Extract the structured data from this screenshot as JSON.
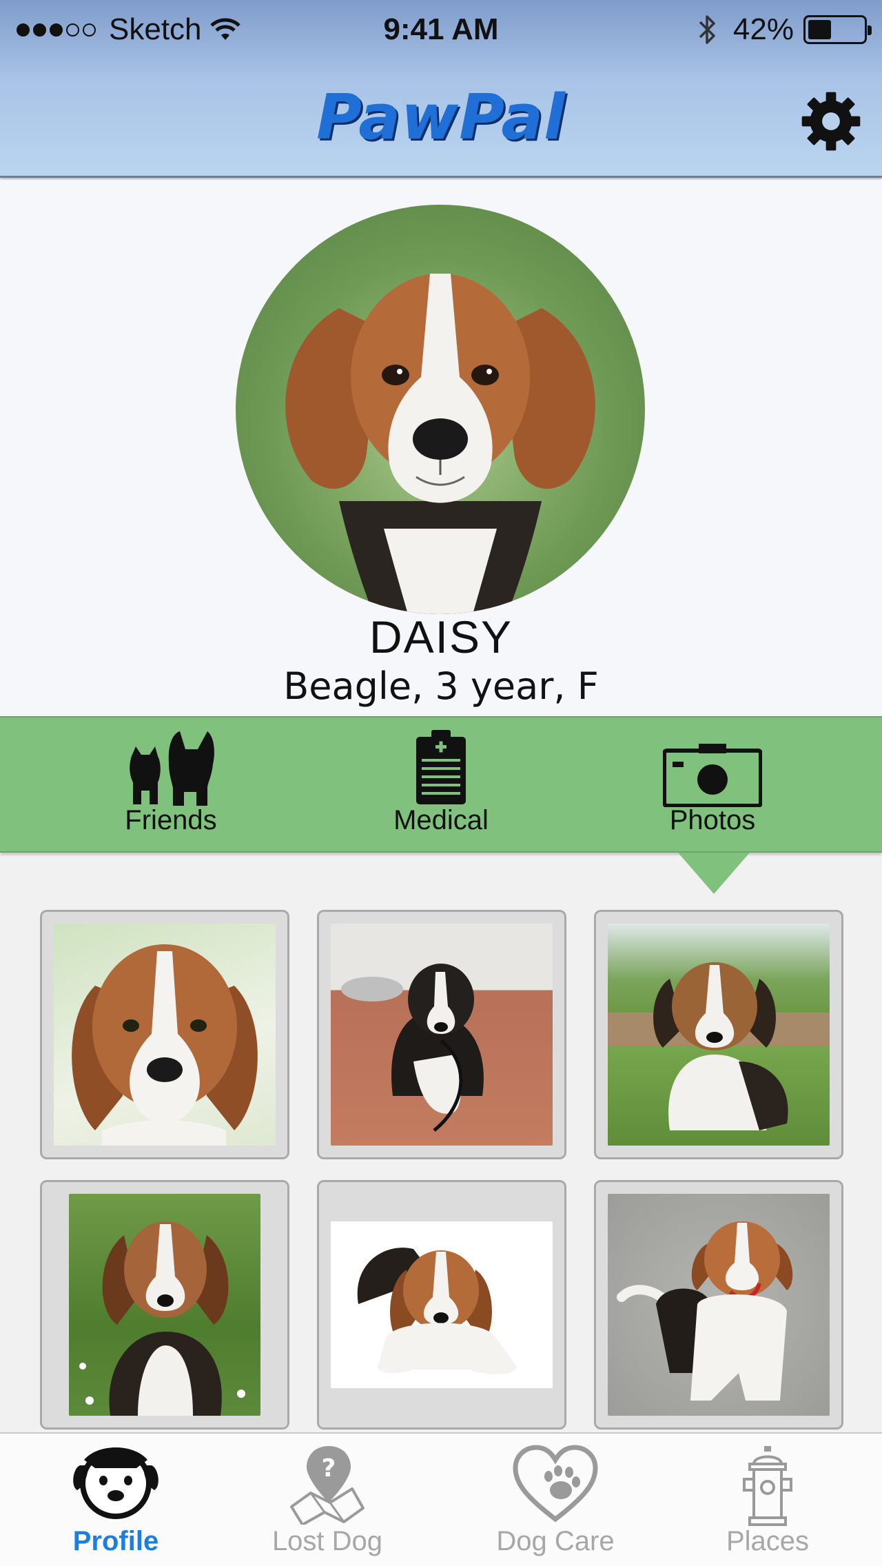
{
  "status_bar": {
    "carrier": "Sketch",
    "time": "9:41 AM",
    "battery": "42%",
    "battery_level": 0.42,
    "signal_bars_filled": 3,
    "signal_bars_total": 5
  },
  "header": {
    "title": "PawPal",
    "settings_icon": "gear-icon"
  },
  "profile": {
    "name": "DAISY",
    "details": "Beagle, 3 year, F"
  },
  "actions": [
    {
      "id": "friends",
      "label": "Friends",
      "icon": "pets-icon"
    },
    {
      "id": "medical",
      "label": "Medical",
      "icon": "clipboard-icon"
    },
    {
      "id": "photos",
      "label": "Photos",
      "icon": "camera-icon"
    }
  ],
  "selected_action": "photos",
  "photos": [
    {
      "subject": "beagle puppy close-up"
    },
    {
      "subject": "beagle puppy on brick floor with leash"
    },
    {
      "subject": "beagle puppy sitting on grass"
    },
    {
      "subject": "beagle puppy sitting in clover"
    },
    {
      "subject": "beagle puppy lying on white background"
    },
    {
      "subject": "beagle sitting on gravel"
    }
  ],
  "tabs": [
    {
      "id": "profile",
      "label": "Profile",
      "icon": "dog-face-icon",
      "active": true
    },
    {
      "id": "lost-dog",
      "label": "Lost Dog",
      "icon": "map-pin-question-icon",
      "active": false
    },
    {
      "id": "dog-care",
      "label": "Dog Care",
      "icon": "heart-paw-icon",
      "active": false
    },
    {
      "id": "places",
      "label": "Places",
      "icon": "fire-hydrant-icon",
      "active": false
    }
  ],
  "colors": {
    "header_gradient_top": "#7f9ccb",
    "header_gradient_bottom": "#bad5ef",
    "logo": "#1f6fd6",
    "action_bar": "#80c17e",
    "active_tab": "#1b7fe0",
    "inactive_tab": "#a7a7a7"
  }
}
